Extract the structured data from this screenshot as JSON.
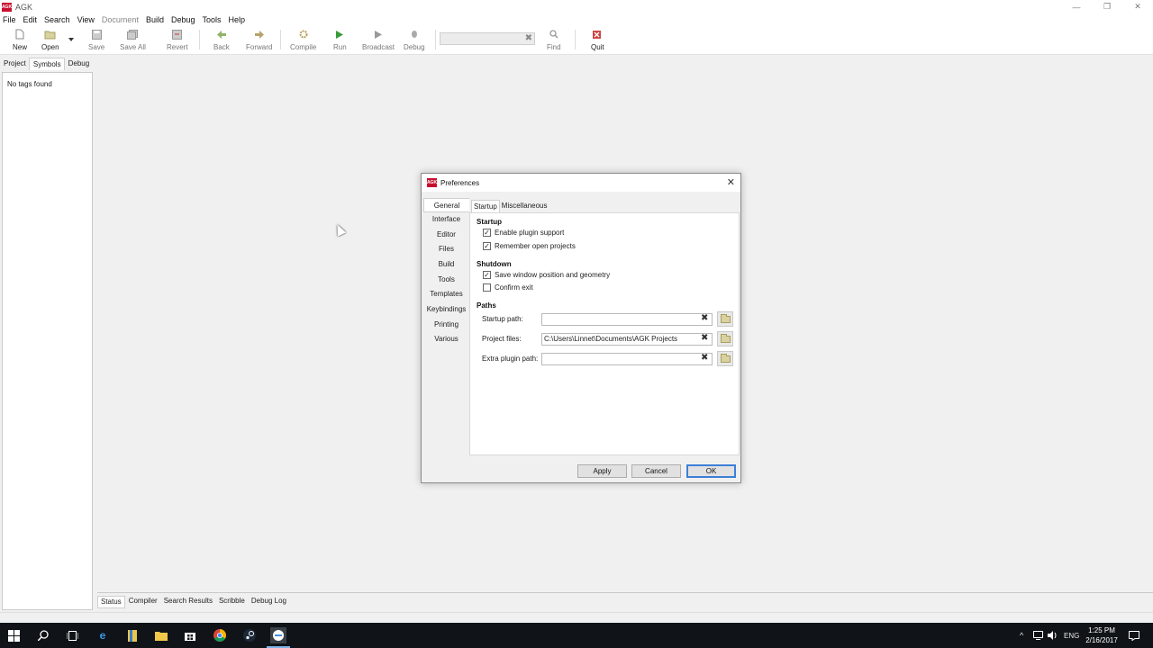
{
  "window": {
    "title": "AGK",
    "logo_text": "AGK",
    "controls": [
      "—",
      "❐",
      "✕"
    ]
  },
  "menu": [
    "File",
    "Edit",
    "Search",
    "View",
    "Document",
    "Build",
    "Debug",
    "Tools",
    "Help"
  ],
  "toolbar": {
    "new": "New",
    "open": "Open",
    "save": "Save",
    "save_all": "Save All",
    "revert": "Revert",
    "back": "Back",
    "forward": "Forward",
    "compile": "Compile",
    "run": "Run",
    "broadcast": "Broadcast",
    "debug": "Debug",
    "find": "Find",
    "quit": "Quit",
    "search_value": ""
  },
  "sidebar": {
    "tabs": [
      "Project",
      "Symbols",
      "Debug"
    ],
    "message": "No tags found"
  },
  "bottom_tabs": [
    "Status",
    "Compiler",
    "Search Results",
    "Scribble",
    "Debug Log"
  ],
  "dialog": {
    "title": "Preferences",
    "left_tabs": [
      "General",
      "Interface",
      "Editor",
      "Files",
      "Build",
      "Tools",
      "Templates",
      "Keybindings",
      "Printing",
      "Various"
    ],
    "inner_tabs": [
      "Startup",
      "Miscellaneous"
    ],
    "startup": {
      "heading": "Startup",
      "enable_plugin": {
        "label": "Enable plugin support",
        "checked": true
      },
      "remember_projects": {
        "label": "Remember open projects",
        "checked": true
      }
    },
    "shutdown": {
      "heading": "Shutdown",
      "save_window": {
        "label": "Save window position and geometry",
        "checked": true
      },
      "confirm_exit": {
        "label": "Confirm exit",
        "checked": false
      }
    },
    "paths": {
      "heading": "Paths",
      "startup_path": {
        "label": "Startup path:",
        "value": ""
      },
      "project_files": {
        "label": "Project files:",
        "value": "C:\\Users\\Linnet\\Documents\\AGK Projects"
      },
      "extra_plugin": {
        "label": "Extra plugin path:",
        "value": ""
      }
    },
    "buttons": {
      "apply": "Apply",
      "cancel": "Cancel",
      "ok": "OK"
    }
  },
  "taskbar": {
    "language": "ENG",
    "time": "1:25 PM",
    "date": "2/16/2017"
  }
}
